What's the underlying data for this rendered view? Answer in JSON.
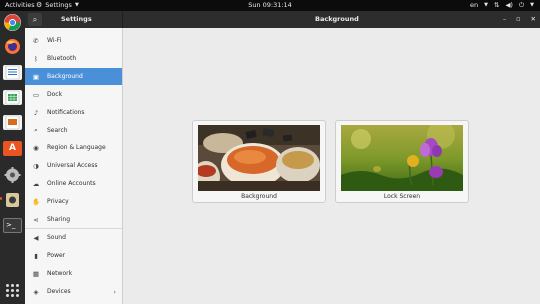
{
  "topbar": {
    "activities": "Activities",
    "app_menu": "Settings",
    "clock": "Sun 09:31:14",
    "lang": "en"
  },
  "dock": {
    "apps": [
      "chrome-browser",
      "firefox",
      "libreoffice-writer",
      "libreoffice-calc",
      "libreoffice-impress",
      "ubuntu-software",
      "system-settings",
      "files",
      "terminal"
    ],
    "accent": "#e95420"
  },
  "window": {
    "left_title": "Settings",
    "main_title": "Background"
  },
  "sidebar": {
    "items": [
      {
        "label": "Wi-Fi",
        "icon": "wifi-icon"
      },
      {
        "label": "Bluetooth",
        "icon": "bluetooth-icon"
      },
      {
        "label": "Background",
        "icon": "background-icon",
        "active": true
      },
      {
        "label": "Dock",
        "icon": "dock-icon"
      },
      {
        "label": "Notifications",
        "icon": "bell-icon"
      },
      {
        "label": "Search",
        "icon": "search-icon"
      },
      {
        "label": "Region & Language",
        "icon": "camera-icon"
      },
      {
        "label": "Universal Access",
        "icon": "accessibility-icon"
      },
      {
        "label": "Online Accounts",
        "icon": "cloud-icon"
      },
      {
        "label": "Privacy",
        "icon": "hand-icon"
      },
      {
        "label": "Sharing",
        "icon": "share-icon"
      },
      {
        "label": "Sound",
        "icon": "speaker-icon"
      },
      {
        "label": "Power",
        "icon": "power-icon"
      },
      {
        "label": "Network",
        "icon": "network-icon"
      },
      {
        "label": "Devices",
        "icon": "devices-icon"
      }
    ],
    "active_color": "#4a90d9"
  },
  "main": {
    "background_card_label": "Background",
    "lockscreen_card_label": "Lock Screen"
  }
}
